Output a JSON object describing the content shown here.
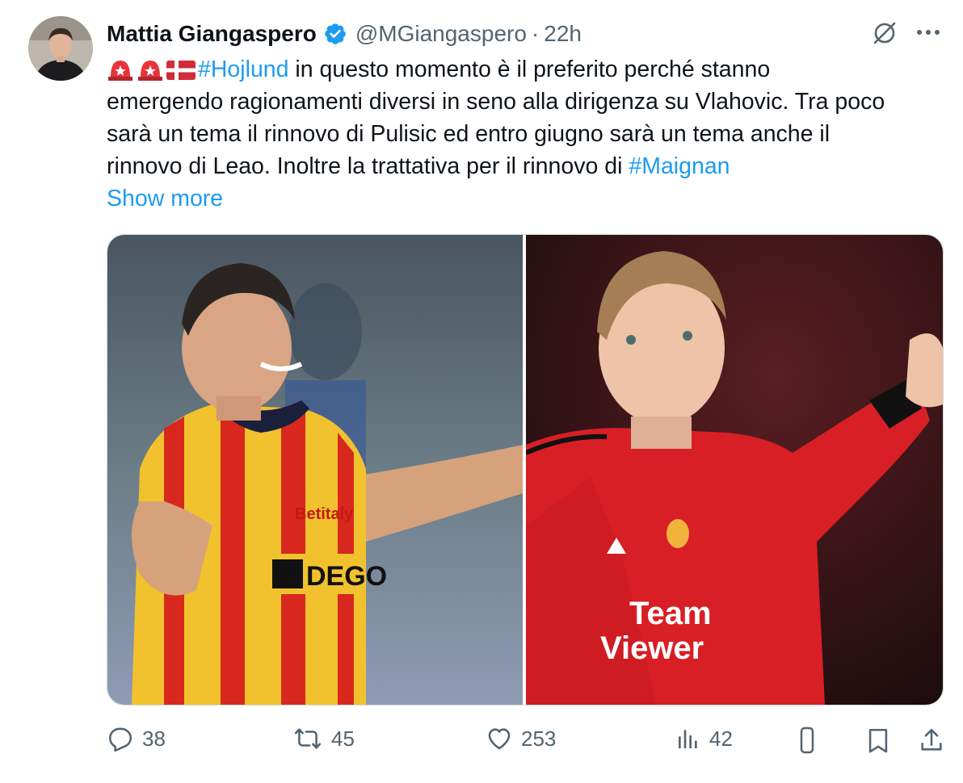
{
  "author": {
    "name": "Mattia Giangaspero",
    "handle": "@MGiangaspero",
    "separator": "·",
    "time": "22h"
  },
  "tweet": {
    "line1_before": "🚨🚨🇩🇰",
    "hashtag1": "#Hojlund",
    "line1_after": " in questo momento è il preferito perché stanno",
    "line2": "emergendo ragionamenti diversi in seno alla dirigenza su Vlahovic. Tra poco",
    "line3": "sarà un tema il rinnovo di Pulisic ed entro giugno sarà un tema anche il",
    "line4_before": "rinnovo di Leao. Inoltre la trattativa per il rinnovo di ",
    "hashtag2": "#Maignan",
    "show_more": "Show more"
  },
  "media": {
    "left_photo": {
      "icon": "photo-player-lecce",
      "sponsor_text": "DEGO",
      "sleeve_text": "Betitaly"
    },
    "right_photo": {
      "icon": "photo-player-man-utd",
      "sponsor_text_1": "Team",
      "sponsor_text_2": "Viewer"
    }
  },
  "actions": {
    "replies": "38",
    "reposts": "45",
    "likes": "253",
    "views": "42"
  },
  "colors": {
    "link": "#1d9bf0",
    "text": "#0f1419",
    "muted": "#536471",
    "verified": "#1d9bf0"
  }
}
